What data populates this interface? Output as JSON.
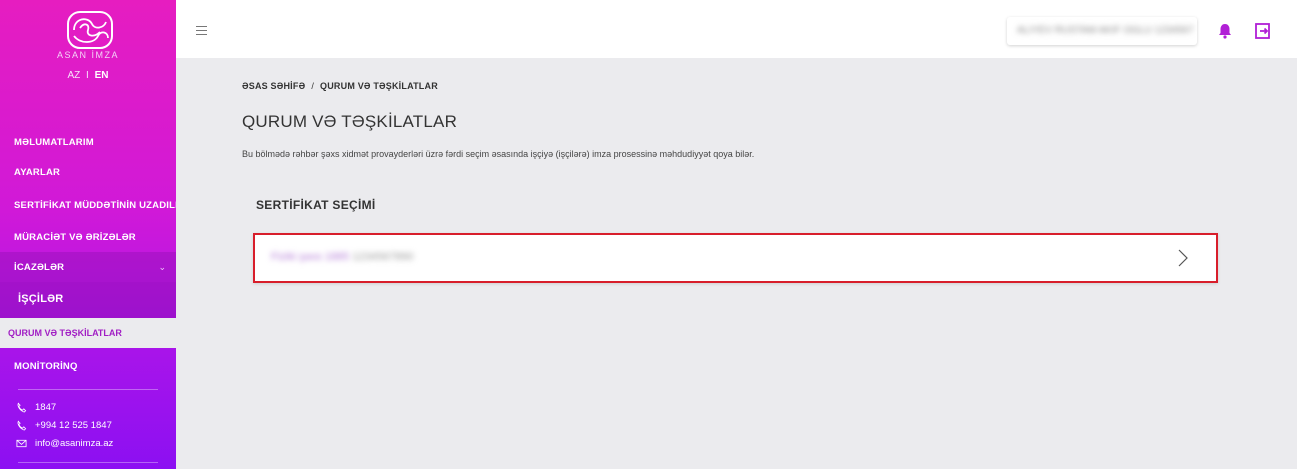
{
  "sidebar": {
    "logo_text": "ASAN İMZA",
    "lang_az": "AZ",
    "lang_sep": "I",
    "lang_en": "EN",
    "items": [
      {
        "label": "MƏLUMATLARIM"
      },
      {
        "label": "AYARLAR"
      },
      {
        "label": "SERTİFİKAT MÜDDƏTİNİN UZADILMASI"
      },
      {
        "label": "MÜRACİƏT VƏ ƏRİZƏLƏR"
      },
      {
        "label": "İCAZƏLƏR"
      },
      {
        "label": "İŞÇİLƏR"
      },
      {
        "label": "QURUM VƏ TƏŞKİLATLAR"
      },
      {
        "label": "MONİTORİNQ"
      }
    ],
    "contacts": {
      "phone_short": "1847",
      "phone_full": "+994 12 525 1847",
      "email": "info@asanimza.az"
    }
  },
  "topbar": {
    "user_name": "ALIYEV RUSTAM AKIF OGLU 1234567"
  },
  "main": {
    "breadcrumb_home": "ƏSAS SƏHİFƏ",
    "breadcrumb_sep": "/",
    "breadcrumb_current": "QURUM VƏ TƏŞKİLATLAR",
    "title": "QURUM VƏ TƏŞKİLATLAR",
    "description": "Bu bölmədə rəhbər şəxs xidmət provayderləri üzrə fərdi seçim əsasında işçiyə (işçilərə) imza prosessinə məhdudiyyət qoya bilər.",
    "section_title": "SERTİFİKAT SEÇİMİ",
    "certificate": {
      "name": "Fiziki şəxs 1885",
      "number": "1234567890"
    }
  },
  "colors": {
    "sidebar_top": "#e61dc0",
    "sidebar_bottom": "#8c10f2",
    "accent": "#b11fd6",
    "highlight_border": "#d81e2b"
  }
}
